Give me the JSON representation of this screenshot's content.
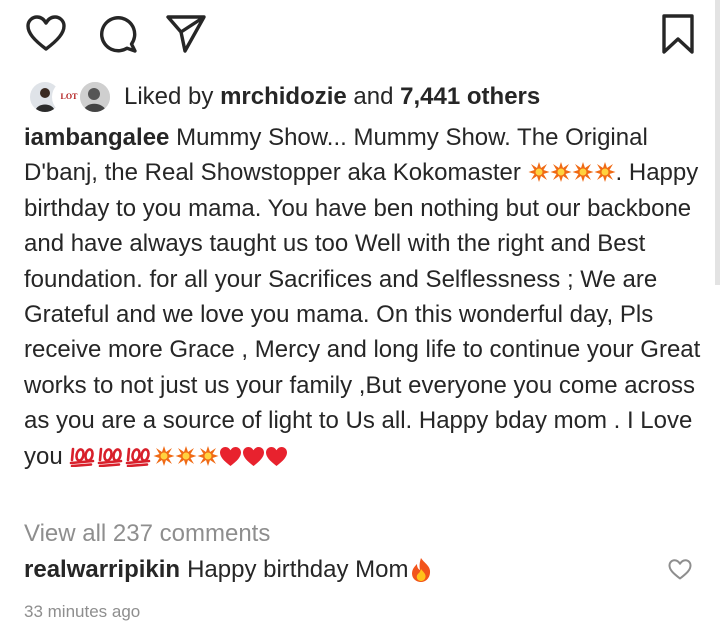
{
  "actions": {
    "like_icon": "heart-outline-icon",
    "comment_icon": "comment-icon",
    "share_icon": "paper-plane-icon",
    "save_icon": "bookmark-icon"
  },
  "likes": {
    "prefix": "Liked by ",
    "user": "mrchidozie",
    "middle": " and ",
    "count": "7,441 others",
    "avatar_badge_text": "LOT"
  },
  "post": {
    "username": "iambangalee",
    "caption_part1": " Mummy Show... Mummy Show. The Original D'banj, the Real Showstopper aka Kokomaster ",
    "caption_part2": ". Happy birthday to you mama. You have ben nothing but our backbone and have always taught us too Well with the right and Best foundation. for all your Sacrifices and Selflessness ; We are Grateful and we love you mama. On this wonderful day, Pls receive more Grace , Mercy and long life to continue your Great works to not just us your family ,But everyone you come across as you are a source of light to Us all. Happy bday mom . I Love you "
  },
  "comments": {
    "view_all": "View all 237 comments",
    "top_comment": {
      "username": "realwarripikin",
      "text": "Happy birthday Mom"
    }
  },
  "timestamp": "33 minutes ago",
  "colors": {
    "text": "#262626",
    "muted": "#8e8e8e",
    "burst": "#f06a14",
    "heart": "#e8222e",
    "hundred": "#d8202b"
  }
}
